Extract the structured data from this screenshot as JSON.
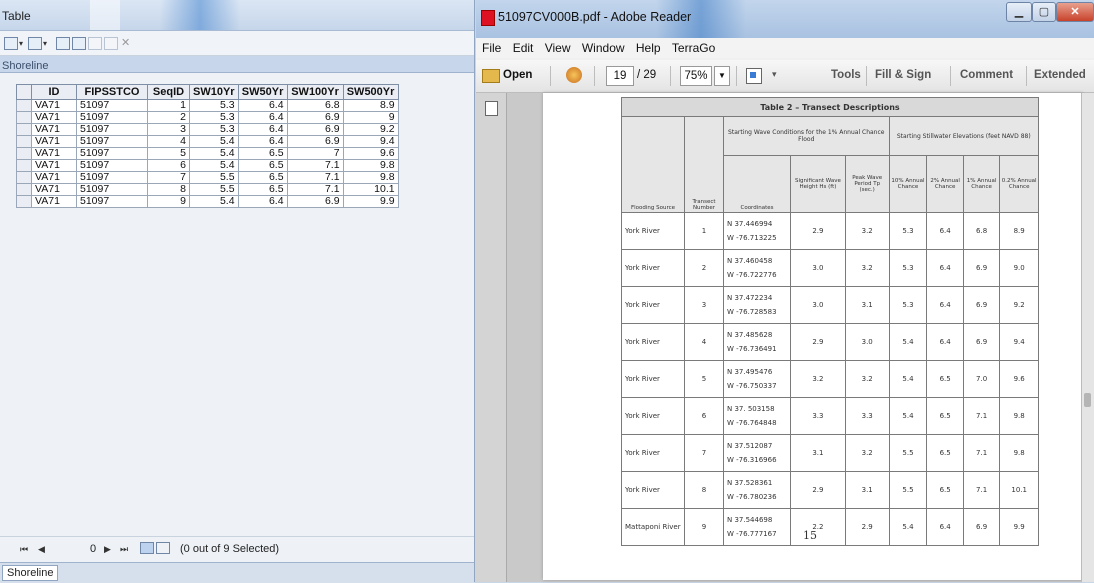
{
  "table_window": {
    "title": "Table",
    "layer_name": "Shoreline",
    "columns": [
      "ID",
      "FIPSSTCO",
      "SeqID",
      "SW10Yr",
      "SW50Yr",
      "SW100Yr",
      "SW500Yr"
    ],
    "rows": [
      [
        "VA71",
        "51097",
        "1",
        "5.3",
        "6.4",
        "6.8",
        "8.9"
      ],
      [
        "VA71",
        "51097",
        "2",
        "5.3",
        "6.4",
        "6.9",
        "9"
      ],
      [
        "VA71",
        "51097",
        "3",
        "5.3",
        "6.4",
        "6.9",
        "9.2"
      ],
      [
        "VA71",
        "51097",
        "4",
        "5.4",
        "6.4",
        "6.9",
        "9.4"
      ],
      [
        "VA71",
        "51097",
        "5",
        "5.4",
        "6.5",
        "7",
        "9.6"
      ],
      [
        "VA71",
        "51097",
        "6",
        "5.4",
        "6.5",
        "7.1",
        "9.8"
      ],
      [
        "VA71",
        "51097",
        "7",
        "5.5",
        "6.5",
        "7.1",
        "9.8"
      ],
      [
        "VA71",
        "51097",
        "8",
        "5.5",
        "6.5",
        "7.1",
        "10.1"
      ],
      [
        "VA71",
        "51097",
        "9",
        "5.4",
        "6.4",
        "6.9",
        "9.9"
      ]
    ],
    "nav": {
      "first": "⏮",
      "prev": "◀",
      "record": "0",
      "next": "▶",
      "last": "⏭",
      "selection_status": "(0 out of 9 Selected)"
    },
    "bottom_tab": "Shoreline"
  },
  "reader": {
    "title": "51097CV000B.pdf - Adobe Reader",
    "menu": [
      "File",
      "Edit",
      "View",
      "Window",
      "Help",
      "TerraGo"
    ],
    "toolbar": {
      "open_label": "Open",
      "page_current": "19",
      "page_total": "/ 29",
      "zoom": "75%",
      "tools": "Tools",
      "fill_sign": "Fill & Sign",
      "comment": "Comment",
      "extended": "Extended"
    },
    "pdf": {
      "table_caption": "Table 2 – Transect Descriptions",
      "group_wave": "Starting Wave Conditions for the 1% Annual Chance Flood",
      "group_stillwater": "Starting Stillwater Elevations (feet NAVD 88)",
      "headers": [
        "Flooding Source",
        "Transect Number",
        "Coordinates",
        "Significant Wave Height Hs (ft)",
        "Peak Wave Period Tp (sec.)",
        "10% Annual Chance",
        "2% Annual Chance",
        "1% Annual Chance",
        "0.2% Annual Chance"
      ],
      "rows": [
        {
          "source": "York River",
          "num": "1",
          "lat": "N 37.446994",
          "lon": "W -76.713225",
          "hs": "2.9",
          "tp": "3.2",
          "s10": "5.3",
          "s2": "6.4",
          "s1": "6.8",
          "s02": "8.9"
        },
        {
          "source": "York River",
          "num": "2",
          "lat": "N 37.460458",
          "lon": "W -76.722776",
          "hs": "3.0",
          "tp": "3.2",
          "s10": "5.3",
          "s2": "6.4",
          "s1": "6.9",
          "s02": "9.0"
        },
        {
          "source": "York River",
          "num": "3",
          "lat": "N 37.472234",
          "lon": "W -76.728583",
          "hs": "3.0",
          "tp": "3.1",
          "s10": "5.3",
          "s2": "6.4",
          "s1": "6.9",
          "s02": "9.2"
        },
        {
          "source": "York River",
          "num": "4",
          "lat": "N 37.485628",
          "lon": "W -76.736491",
          "hs": "2.9",
          "tp": "3.0",
          "s10": "5.4",
          "s2": "6.4",
          "s1": "6.9",
          "s02": "9.4"
        },
        {
          "source": "York River",
          "num": "5",
          "lat": "N 37.495476",
          "lon": "W -76.750337",
          "hs": "3.2",
          "tp": "3.2",
          "s10": "5.4",
          "s2": "6.5",
          "s1": "7.0",
          "s02": "9.6"
        },
        {
          "source": "York River",
          "num": "6",
          "lat": "N 37. 503158",
          "lon": "W -76.764848",
          "hs": "3.3",
          "tp": "3.3",
          "s10": "5.4",
          "s2": "6.5",
          "s1": "7.1",
          "s02": "9.8"
        },
        {
          "source": "York River",
          "num": "7",
          "lat": "N 37.512087",
          "lon": "W -76.316966",
          "hs": "3.1",
          "tp": "3.2",
          "s10": "5.5",
          "s2": "6.5",
          "s1": "7.1",
          "s02": "9.8"
        },
        {
          "source": "York River",
          "num": "8",
          "lat": "N 37.528361",
          "lon": "W -76.780236",
          "hs": "2.9",
          "tp": "3.1",
          "s10": "5.5",
          "s2": "6.5",
          "s1": "7.1",
          "s02": "10.1"
        },
        {
          "source": "Mattaponi River",
          "num": "9",
          "lat": "N 37.544698",
          "lon": "W -76.777167",
          "hs": "2.2",
          "tp": "2.9",
          "s10": "5.4",
          "s2": "6.4",
          "s1": "6.9",
          "s02": "9.9"
        }
      ],
      "page_number": "15"
    }
  }
}
